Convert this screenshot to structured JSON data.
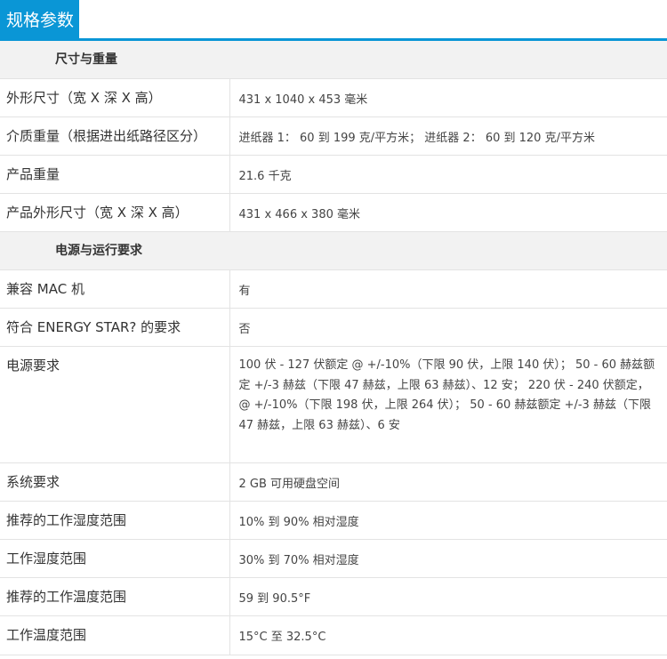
{
  "header": {
    "tab_title": "规格参数"
  },
  "sections": [
    {
      "title": "尺寸与重量",
      "rows": [
        {
          "label": "外形尺寸（宽 X 深 X 高）",
          "value": "431 x 1040 x 453 毫米"
        },
        {
          "label": "介质重量（根据进出纸路径区分）",
          "value": "进纸器 1： 60 到 199 克/平方米； 进纸器 2： 60 到 120 克/平方米"
        },
        {
          "label": "产品重量",
          "value": "21.6 千克"
        },
        {
          "label": "产品外形尺寸（宽 X 深 X 高）",
          "value": "431 x 466 x 380 毫米"
        }
      ]
    },
    {
      "title": "电源与运行要求",
      "rows": [
        {
          "label": "兼容 MAC 机",
          "value": "有"
        },
        {
          "label": "符合 ENERGY STAR? 的要求",
          "value": "否"
        },
        {
          "label": "电源要求",
          "value": "100 伏 - 127 伏额定 @ +/-10%（下限 90 伏，上限 140 伏）； 50 - 60 赫兹额定 +/-3 赫兹（下限 47 赫兹，上限 63 赫兹）、12 安； 220 伏 - 240 伏额定， @ +/-10%（下限 198 伏，上限 264 伏）； 50 - 60 赫兹额定 +/-3 赫兹（下限 47 赫兹，上限 63 赫兹）、6 安"
        },
        {
          "label": "系统要求",
          "value": "2 GB 可用硬盘空间"
        },
        {
          "label": "推荐的工作湿度范围",
          "value": "10% 到 90% 相对湿度"
        },
        {
          "label": "工作湿度范围",
          "value": "30% 到 70% 相对湿度"
        },
        {
          "label": "推荐的工作温度范围",
          "value": "59 到 90.5°F"
        },
        {
          "label": "工作温度范围",
          "value": "15°C 至 32.5°C"
        }
      ]
    }
  ]
}
